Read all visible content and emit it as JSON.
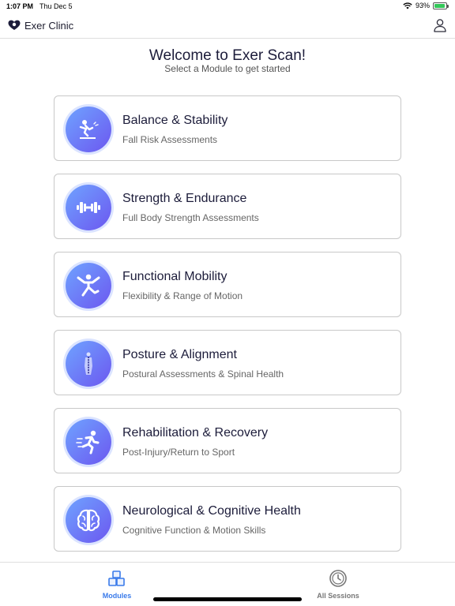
{
  "status_bar": {
    "time": "1:07 PM",
    "date": "Thu Dec 5",
    "battery_percent": "93%",
    "battery_level": 0.93,
    "icons": [
      "wifi-icon",
      "battery-icon"
    ]
  },
  "header": {
    "app_name": "Exer Clinic",
    "logo_icon": "heart-logo-icon",
    "profile_icon": "user-profile-icon"
  },
  "welcome": {
    "title": "Welcome to Exer Scan!",
    "subtitle": "Select a Module to get started"
  },
  "modules": [
    {
      "title": "Balance & Stability",
      "description": "Fall Risk Assessments",
      "icon": "slip-fall-icon"
    },
    {
      "title": "Strength & Endurance",
      "description": "Full Body Strength Assessments",
      "icon": "dumbbell-icon"
    },
    {
      "title": "Functional Mobility",
      "description": "Flexibility & Range of Motion",
      "icon": "stretching-person-icon"
    },
    {
      "title": "Posture & Alignment",
      "description": "Postural Assessments & Spinal Health",
      "icon": "spine-body-icon"
    },
    {
      "title": "Rehabilitation & Recovery",
      "description": "Post-Injury/Return to Sport",
      "icon": "running-person-icon"
    },
    {
      "title": "Neurological & Cognitive Health",
      "description": "Cognitive Function & Motion Skills",
      "icon": "brain-icon"
    }
  ],
  "tab_bar": {
    "modules_label": "Modules",
    "sessions_label": "All Sessions",
    "active_tab": "Modules",
    "active_color": "#3a7bea"
  },
  "colors": {
    "icon_gradient_start": "#6fa3ff",
    "icon_gradient_end": "#6c57f0",
    "accent": "#3a7bea"
  }
}
